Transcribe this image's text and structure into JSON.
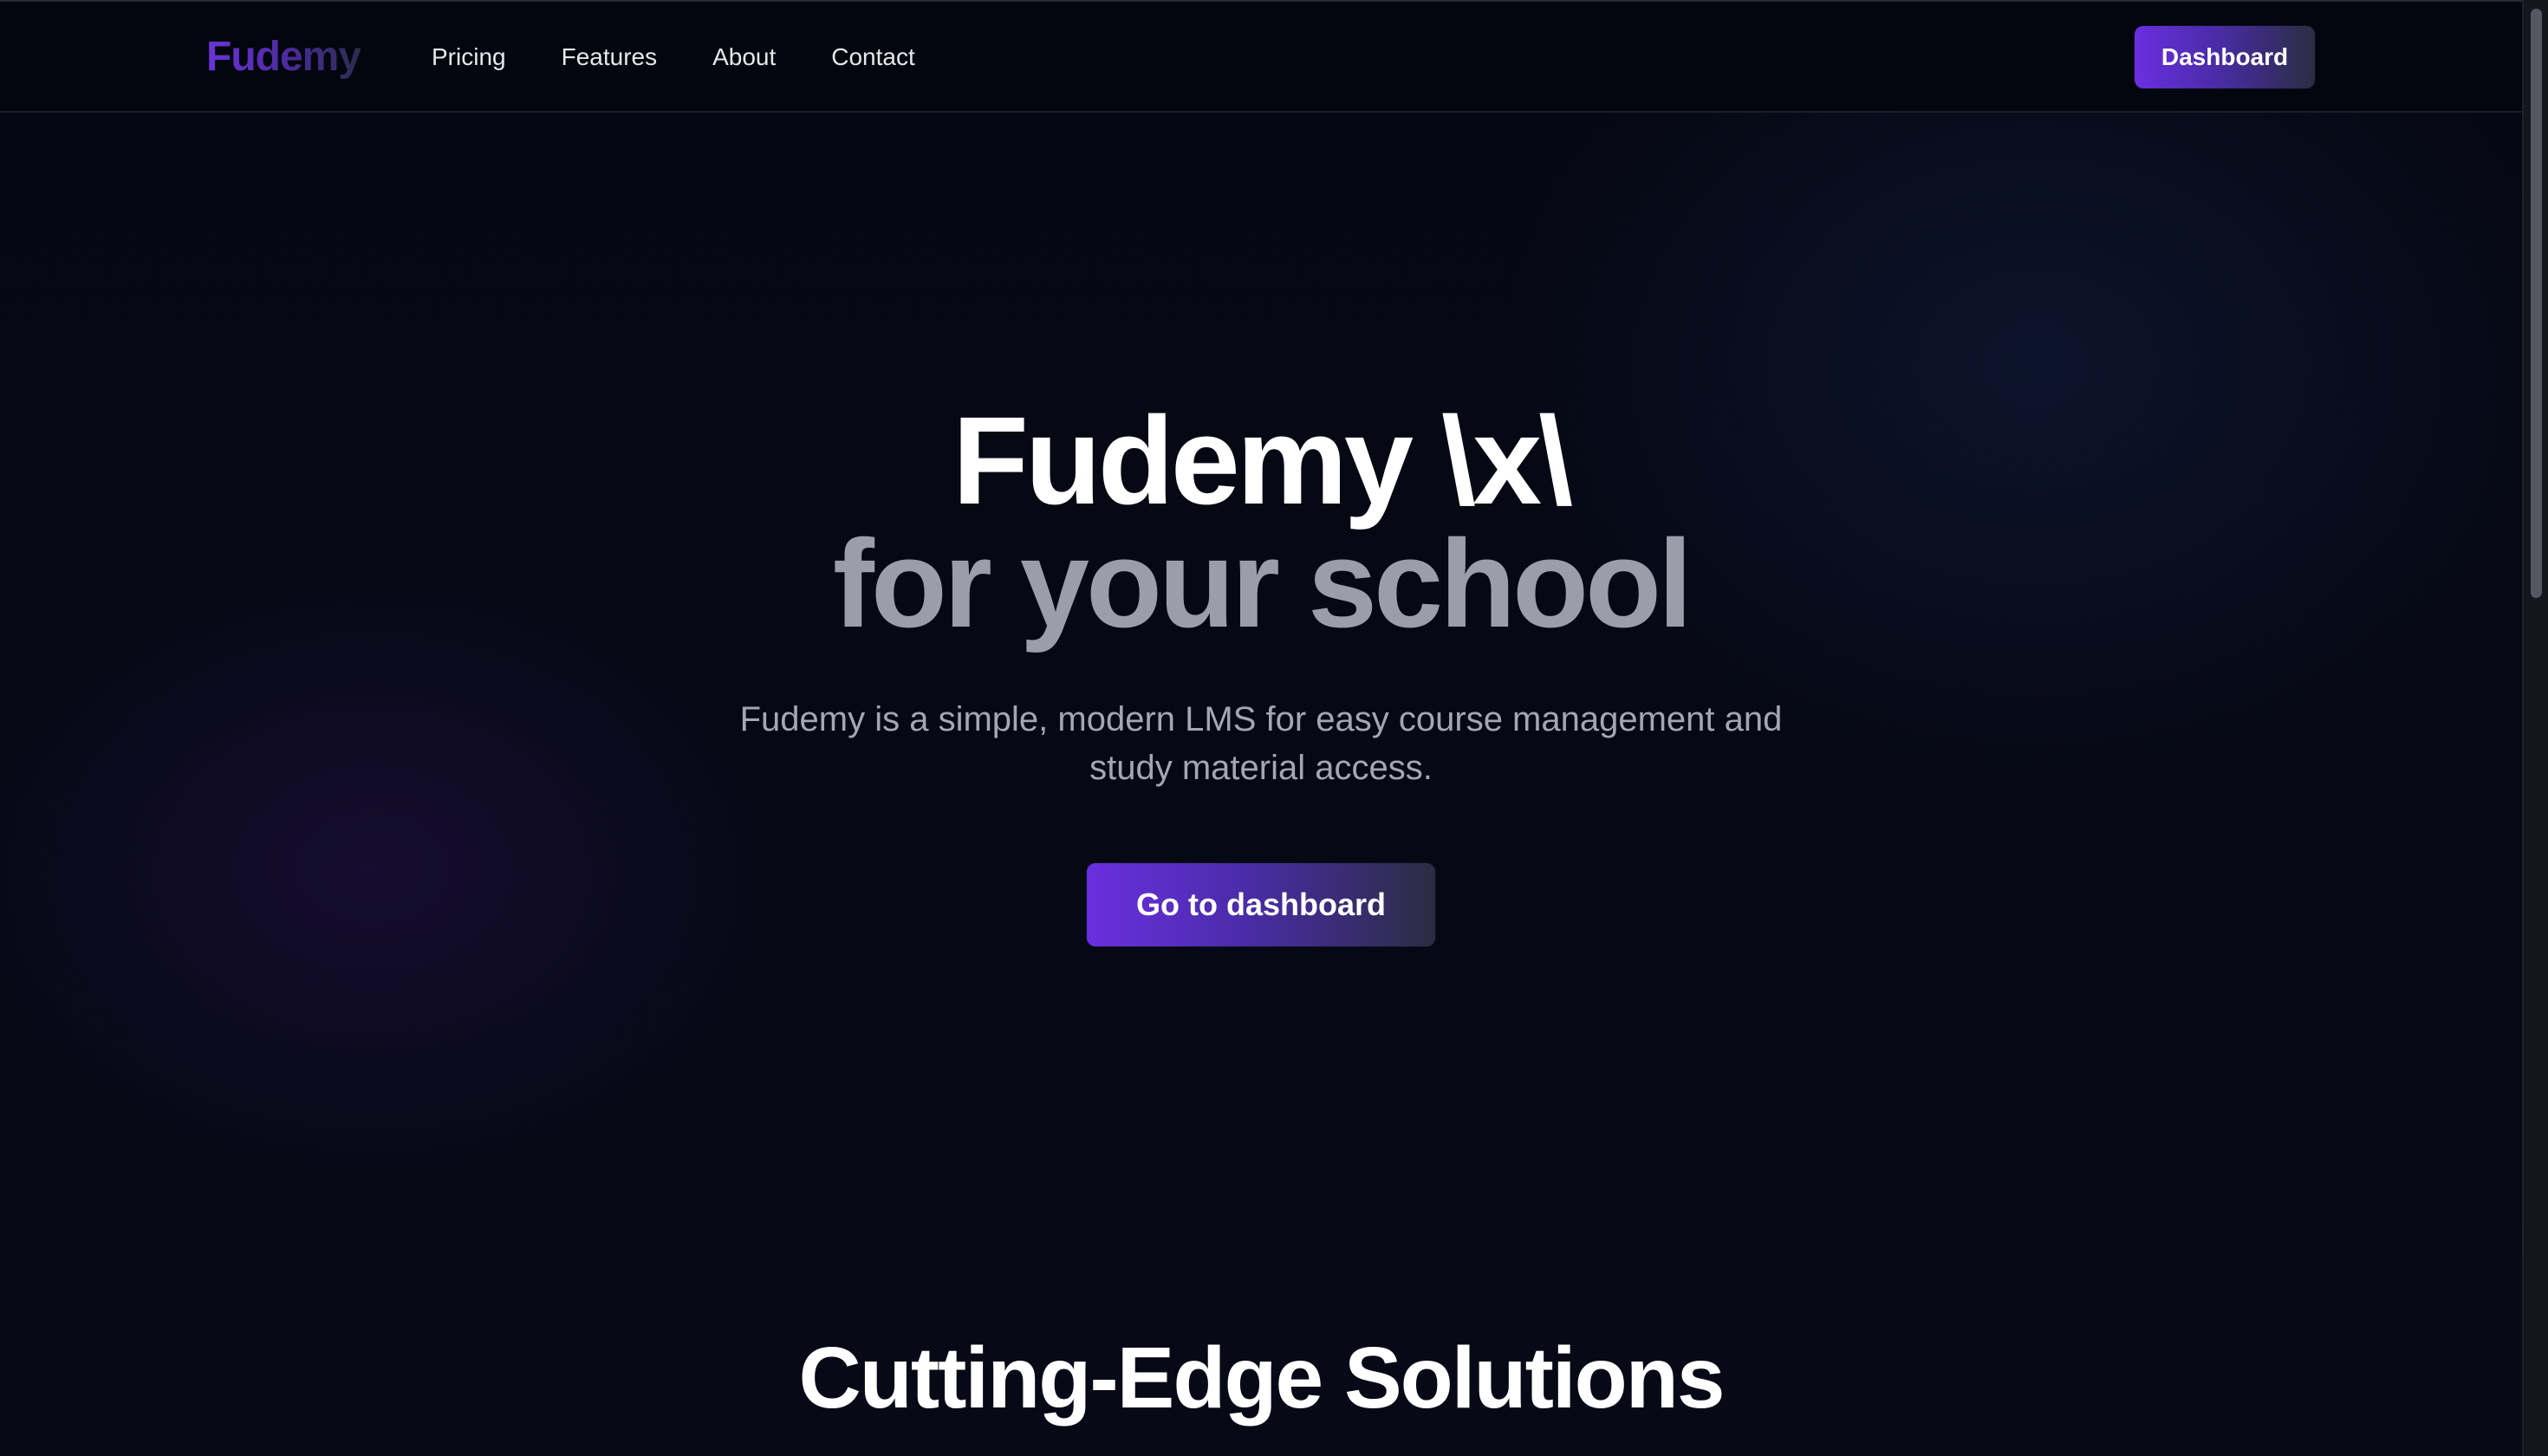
{
  "navbar": {
    "logo": "Fudemy",
    "links": [
      {
        "label": "Pricing"
      },
      {
        "label": "Features"
      },
      {
        "label": "About"
      },
      {
        "label": "Contact"
      }
    ],
    "dashboard_button": "Dashboard"
  },
  "hero": {
    "title_line1": "Fudemy \\x\\",
    "title_line2": "for your school",
    "subtitle": "Fudemy is a simple, modern LMS for easy course management and study material access.",
    "cta_label": "Go to dashboard"
  },
  "features_section": {
    "title": "Cutting-Edge Solutions"
  },
  "colors": {
    "background": "#04060f",
    "accent": "#6a2fe0",
    "subtitle_gray": "#9b9ea9"
  }
}
